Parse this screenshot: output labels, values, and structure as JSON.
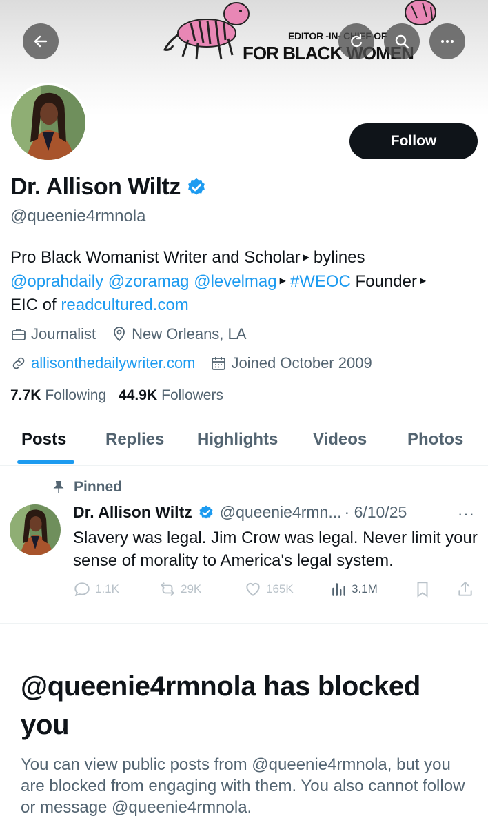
{
  "banner": {
    "small_text": "EDITOR -IN- CHIEF OF",
    "big_text": "FOR BLACK WOMEN"
  },
  "header": {
    "back_icon": "arrow-left-icon",
    "refresh_icon": "refresh-icon",
    "search_icon": "search-icon",
    "more_icon": "more-horizontal-icon"
  },
  "profile": {
    "name": "Dr. Allison Wiltz",
    "handle": "@queenie4rmnola",
    "follow_label": "Follow",
    "bio": {
      "line1_text": "Pro Black Womanist Writer and Scholar",
      "line1_tail": "bylines",
      "mention1": "@oprahdaily",
      "mention2": "@zoramag",
      "mention3": "@levelmag",
      "hashtag": "#WEOC",
      "founder": "Founder",
      "eic_prefix": "EIC of",
      "eic_link": "readcultured.com"
    },
    "profession": "Journalist",
    "location": "New Orleans, LA",
    "website": "allisonthedailywriter.com",
    "joined": "Joined October 2009",
    "following_count": "7.7K",
    "following_label": "Following",
    "followers_count": "44.9K",
    "followers_label": "Followers"
  },
  "tabs": [
    {
      "label": "Posts"
    },
    {
      "label": "Replies"
    },
    {
      "label": "Highlights"
    },
    {
      "label": "Videos"
    },
    {
      "label": "Photos"
    }
  ],
  "pinned_post": {
    "pinned_label": "Pinned",
    "author_name": "Dr. Allison Wiltz",
    "author_handle": "@queenie4rmn...",
    "date": "· 6/10/25",
    "more": "···",
    "text": "Slavery was legal. Jim Crow was legal. Never limit your sense of morality to America's legal system.",
    "replies": "1.1K",
    "reposts": "29K",
    "likes": "165K",
    "views": "3.1M"
  },
  "blocked": {
    "title": "@queenie4rmnola has blocked you",
    "description": "You can view public posts from @queenie4rmnola, but you are blocked from engaging with them. You also cannot follow or message @queenie4rmnola."
  },
  "colors": {
    "accent": "#1d9bf0",
    "text_primary": "#0f1419",
    "text_secondary": "#536471",
    "button_dark": "#0f1419"
  }
}
